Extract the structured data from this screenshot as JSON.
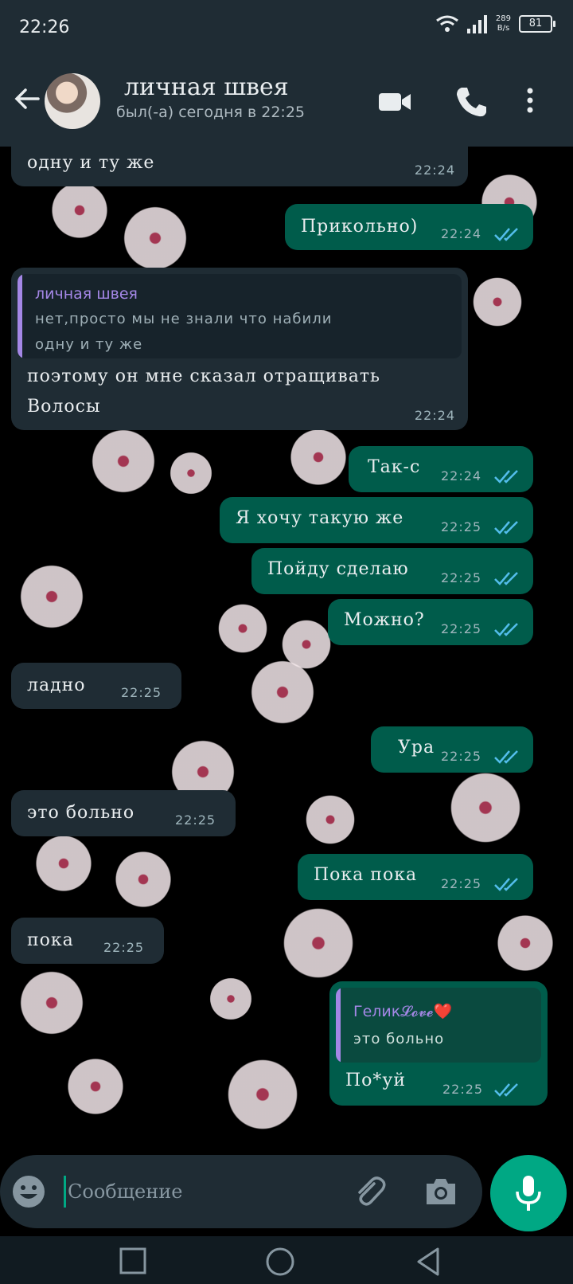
{
  "status_bar": {
    "time": "22:26",
    "speed_value": "289",
    "speed_unit": "B/s",
    "battery": "81"
  },
  "header": {
    "contact_name": "личная швея",
    "contact_status": "был(-а) сегодня в 22:25"
  },
  "messages": [
    {
      "dir": "in",
      "text": "одну и ту же",
      "time": "22:24"
    },
    {
      "dir": "out",
      "text": "Прикольно)",
      "time": "22:24",
      "read": true
    },
    {
      "dir": "in",
      "quote_author": "личная швея",
      "quote_line1": "нет,просто мы не знали что набили",
      "quote_line2": "одну и ту же",
      "text_line1": "поэтому он мне сказал отращивать",
      "text_line2": "Волосы",
      "time": "22:24"
    },
    {
      "dir": "out",
      "text": "Так-с",
      "time": "22:24",
      "read": true
    },
    {
      "dir": "out",
      "text": "Я хочу такую же",
      "time": "22:25",
      "read": true
    },
    {
      "dir": "out",
      "text": "Пойду сделаю",
      "time": "22:25",
      "read": true
    },
    {
      "dir": "out",
      "text": "Можно?",
      "time": "22:25",
      "read": true
    },
    {
      "dir": "in",
      "text": "ладно",
      "time": "22:25"
    },
    {
      "dir": "out",
      "text": "Ура",
      "time": "22:25",
      "read": true
    },
    {
      "dir": "in",
      "text": "это больно",
      "time": "22:25"
    },
    {
      "dir": "out",
      "text": "Пока пока",
      "time": "22:25",
      "read": true
    },
    {
      "dir": "in",
      "text": "пока",
      "time": "22:25"
    },
    {
      "dir": "out",
      "quote_author": "Гелик𝓛𝓸𝓿𝓮❤️",
      "quote_line1": "это больно",
      "text": "По*уй",
      "time": "22:25",
      "read": true
    }
  ],
  "input": {
    "placeholder": "Сообщение"
  },
  "colors": {
    "header_bg": "#1f2c34",
    "incoming_bubble": "#1f2c34",
    "outgoing_bubble": "#005c4b",
    "accent": "#00a884",
    "read_ticks": "#53bdeb",
    "quote_author": "#a487e6"
  },
  "icons": {
    "back": "arrow-left",
    "video": "video-camera",
    "call": "phone",
    "menu": "three-dots-vertical",
    "emoji": "smiley",
    "attach": "paperclip",
    "camera": "camera",
    "mic": "microphone"
  }
}
